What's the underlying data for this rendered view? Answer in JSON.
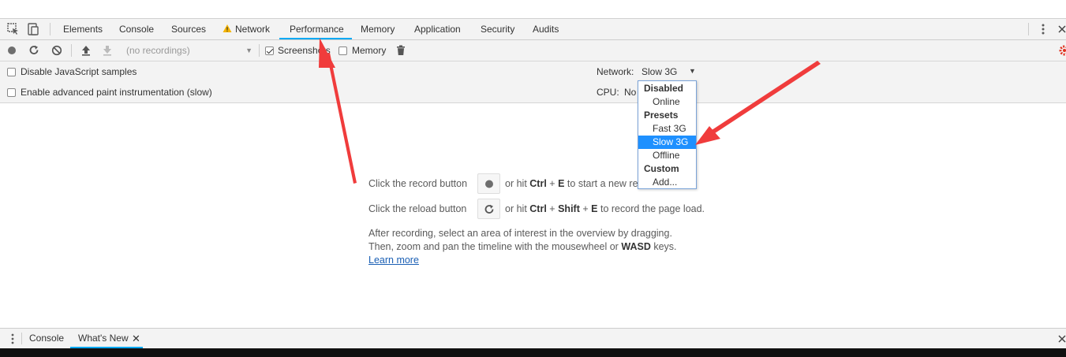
{
  "tabs": [
    "Elements",
    "Console",
    "Sources",
    "Network",
    "Performance",
    "Memory",
    "Application",
    "Security",
    "Audits"
  ],
  "active_tab": "Performance",
  "toolbar": {
    "recordings_placeholder": "(no recordings)",
    "screenshots_label": "Screenshots",
    "memory_label": "Memory"
  },
  "settings": {
    "disable_js_samples": "Disable JavaScript samples",
    "advanced_paint": "Enable advanced paint instrumentation (slow)",
    "network_label": "Network:",
    "network_value": "Slow 3G",
    "cpu_label": "CPU:",
    "cpu_value": "No"
  },
  "network_dropdown": {
    "groups": [
      {
        "label": "Disabled",
        "options": [
          "Online"
        ]
      },
      {
        "label": "Presets",
        "options": [
          "Fast 3G",
          "Slow 3G",
          "Offline"
        ]
      },
      {
        "label": "Custom",
        "options": [
          "Add..."
        ]
      }
    ],
    "selected": "Slow 3G"
  },
  "landing": {
    "record_prefix": "Click the record button",
    "record_hint": "or hit",
    "record_key1": "Ctrl",
    "record_plus": "+",
    "record_key2": "E",
    "record_suffix": "to start a new re",
    "reload_prefix": "Click the reload button",
    "reload_hint": "or hit",
    "reload_key1": "Ctrl",
    "reload_key2": "Shift",
    "reload_key3": "E",
    "reload_suffix": "to record the page load.",
    "after_line1": "After recording, select an area of interest in the overview by dragging.",
    "after_line2a": "Then, zoom and pan the timeline with the mousewheel or",
    "after_line2b": "WASD",
    "after_line2c": "keys.",
    "learn_more": "Learn more"
  },
  "drawer": {
    "tabs": [
      "Console",
      "What's New"
    ],
    "active": "What's New"
  },
  "colors": {
    "tab_underline": "#03a9f4",
    "dropdown_selected": "#1e90ff",
    "annotation_arrow": "#f03c3c",
    "warning": "#f5b400"
  }
}
